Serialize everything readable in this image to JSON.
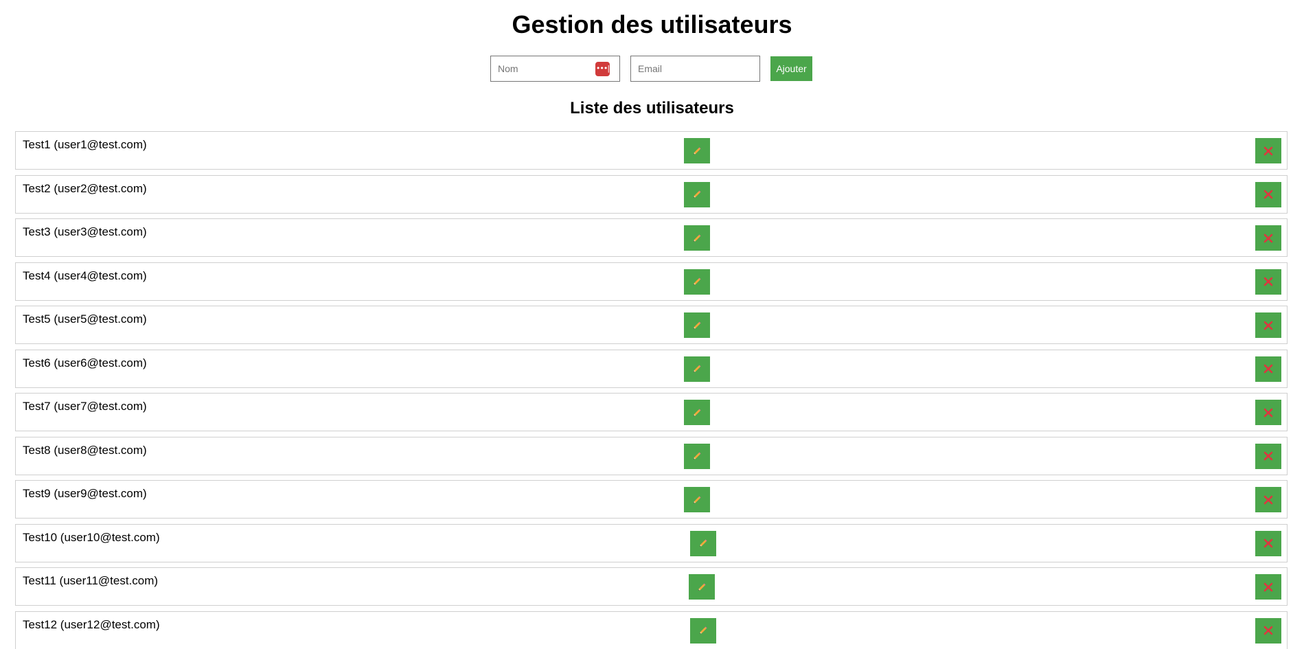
{
  "header": {
    "title": "Gestion des utilisateurs"
  },
  "form": {
    "name_placeholder": "Nom",
    "email_placeholder": "Email",
    "add_label": "Ajouter",
    "password_manager_icon": "password-manager-icon"
  },
  "list": {
    "title": "Liste des utilisateurs",
    "users": [
      {
        "label": "Test1 (user1@test.com)"
      },
      {
        "label": "Test2 (user2@test.com)"
      },
      {
        "label": "Test3 (user3@test.com)"
      },
      {
        "label": "Test4 (user4@test.com)"
      },
      {
        "label": "Test5 (user5@test.com)"
      },
      {
        "label": "Test6 (user6@test.com)"
      },
      {
        "label": "Test7 (user7@test.com)"
      },
      {
        "label": "Test8 (user8@test.com)"
      },
      {
        "label": "Test9 (user9@test.com)"
      },
      {
        "label": "Test10 (user10@test.com)"
      },
      {
        "label": "Test11 (user11@test.com)"
      },
      {
        "label": "Test12 (user12@test.com)"
      }
    ],
    "edit_icon": "pencil-icon",
    "delete_icon": "cross-mark-icon"
  },
  "colors": {
    "button_green": "#4ba64b",
    "delete_cross": "#e0343f",
    "password_icon_red": "#d13b3b"
  }
}
